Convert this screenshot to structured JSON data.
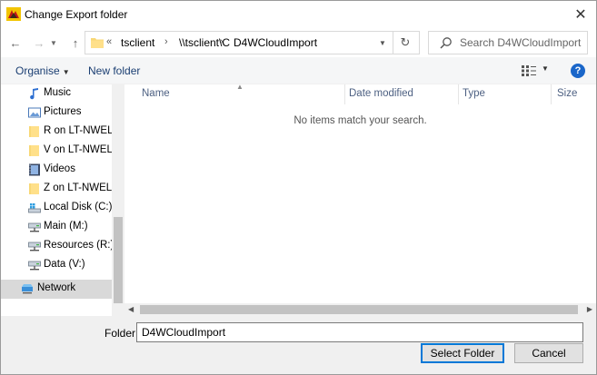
{
  "window": {
    "title": "Change Export folder"
  },
  "nav": {
    "breadcrumbs": [
      "tsclient",
      "\\\\tsclient\\C",
      "D4WCloudImport"
    ],
    "overflow_chevron": "«",
    "search_placeholder": "Search D4WCloudImport"
  },
  "toolbar": {
    "organise_label": "Organise",
    "new_folder_label": "New folder",
    "help_label": "?"
  },
  "sidebar": {
    "items": [
      {
        "label": "Music",
        "icon": "music-icon"
      },
      {
        "label": "Pictures",
        "icon": "pictures-icon"
      },
      {
        "label": "R on LT-NWELLS",
        "icon": "folder-icon"
      },
      {
        "label": "V on LT-NWELLS",
        "icon": "folder-icon"
      },
      {
        "label": "Videos",
        "icon": "videos-icon"
      },
      {
        "label": "Z on LT-NWELLS",
        "icon": "folder-icon"
      },
      {
        "label": "Local Disk (C:)",
        "icon": "local-disk-icon"
      },
      {
        "label": "Main (M:)",
        "icon": "network-drive-icon"
      },
      {
        "label": "Resources (R:)",
        "icon": "network-drive-icon"
      },
      {
        "label": "Data (V:)",
        "icon": "network-drive-icon"
      },
      {
        "label": "Network",
        "icon": "network-icon"
      }
    ]
  },
  "list": {
    "columns": [
      "Name",
      "Date modified",
      "Type",
      "Size"
    ],
    "empty_message": "No items match your search."
  },
  "footer": {
    "folder_label": "Folder:",
    "folder_value": "D4WCloudImport",
    "select_label": "Select Folder",
    "cancel_label": "Cancel"
  },
  "colors": {
    "accent": "#0078d7",
    "link": "#1a3e72",
    "selected_bg": "#d9d9d9"
  }
}
